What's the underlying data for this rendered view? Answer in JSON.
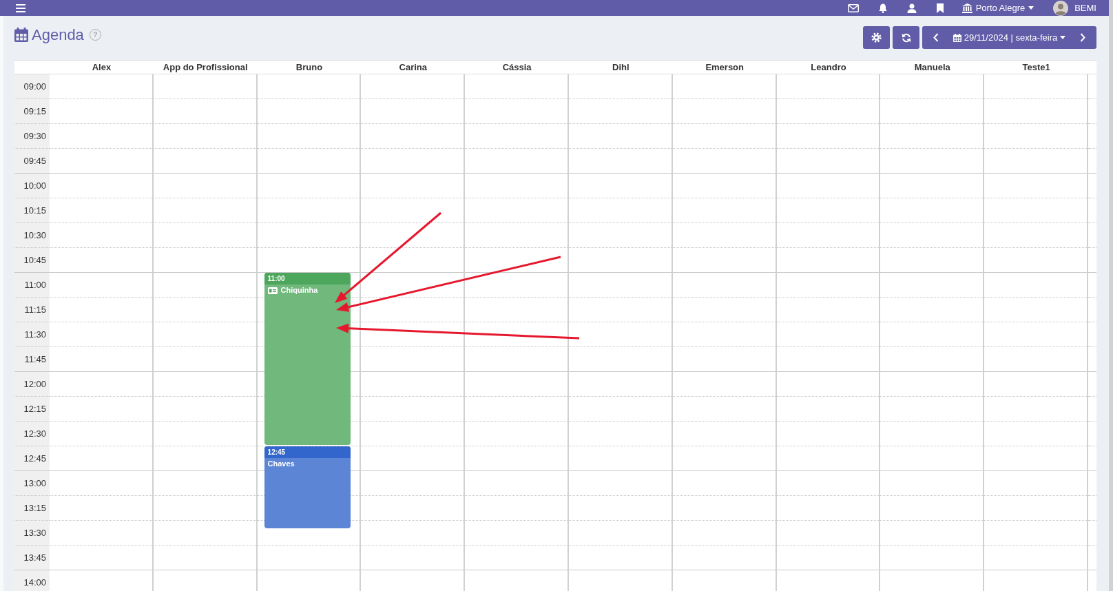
{
  "top_bar": {
    "location": "Porto Alegre",
    "user": "BEMI"
  },
  "header": {
    "title": "Agenda",
    "help": "?",
    "date": "29/11/2024 | sexta-feira"
  },
  "schedule": {
    "columns": [
      {
        "name": "Alex"
      },
      {
        "name": "App do Profissional"
      },
      {
        "name": "Bruno",
        "events": [
          {
            "time": "11:00",
            "title": "Chiquinha",
            "card_icon": true,
            "color": "#4ca65b"
          },
          {
            "time": "12:45",
            "title": "Chaves",
            "card_icon": false,
            "color": "#3366cc"
          }
        ]
      },
      {
        "name": "Carina"
      },
      {
        "name": "Cássia"
      },
      {
        "name": "Dihl"
      },
      {
        "name": "Emerson"
      },
      {
        "name": "Leandro"
      },
      {
        "name": "Manuela"
      },
      {
        "name": "Teste1"
      }
    ],
    "times": [
      "09:00",
      "09:15",
      "09:30",
      "09:45",
      "10:00",
      "10:15",
      "10:30",
      "10:45",
      "11:00",
      "11:15",
      "11:30",
      "11:45",
      "12:00",
      "12:15",
      "12:30",
      "12:45",
      "13:00",
      "13:15",
      "13:30",
      "13:45",
      "14:00"
    ]
  },
  "annotations": [
    {
      "kind": "arrow"
    },
    {
      "kind": "arrow"
    },
    {
      "kind": "arrow"
    }
  ]
}
